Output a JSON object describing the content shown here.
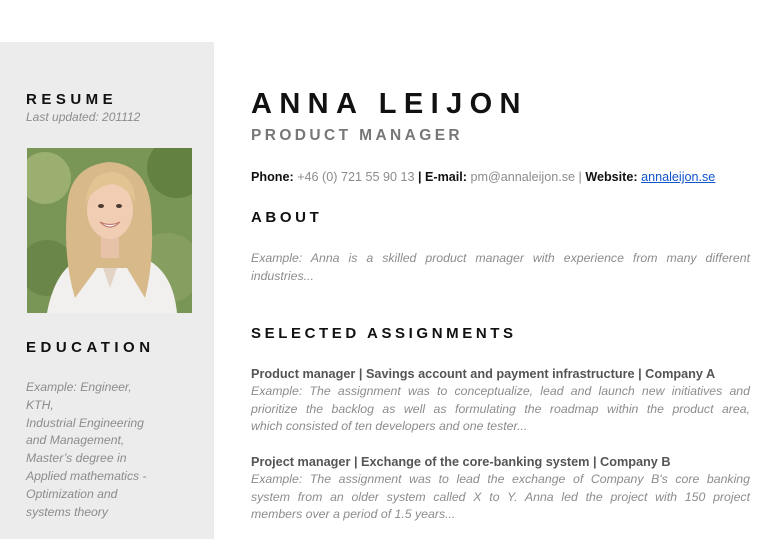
{
  "sidebar": {
    "resume_heading": "RESUME",
    "last_updated": "Last updated: 201112",
    "education_heading": "EDUCATION",
    "education_lines": [
      "Example: Engineer,",
      "KTH,",
      "Industrial Engineering",
      "and Management,",
      "Master’s degree in",
      "Applied mathematics -",
      "Optimization and",
      "systems theory"
    ]
  },
  "header": {
    "name": "ANNA LEIJON",
    "role": "PRODUCT MANAGER"
  },
  "contact": {
    "phone_label": "Phone:",
    "phone": "+46 (0) 721 55 90 13",
    "email_label": "E-mail:",
    "email": "pm@annaleijon.se",
    "website_label": "Website:",
    "website": "annaleijon.se",
    "separator": "|",
    "link_color": "#1155cc"
  },
  "about": {
    "heading": "ABOUT",
    "lines": [
      "Example: Anna is a skilled product manager with experience from many different",
      "industries..."
    ]
  },
  "assignments": {
    "heading": "SELECTED ASSIGNMENTS",
    "items": [
      {
        "title": "Product manager | Savings account and payment infrastructure | Company A",
        "lines": [
          "Example: The assignment was to conceptualize, lead and launch new initiatives and",
          "prioritize the backlog as well as formulating the roadmap within the product area,",
          "which consisted of ten developers and one tester..."
        ]
      },
      {
        "title": "Project manager | Exchange of the core-banking system | Company B",
        "lines": [
          "Example: The assignment was to lead the exchange of Company B's core banking",
          "system from an older system called X to Y. Anna led the project with 150 project",
          "members over a period of 1.5 years..."
        ]
      }
    ]
  }
}
